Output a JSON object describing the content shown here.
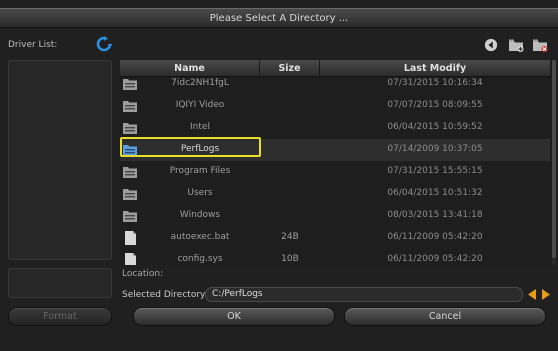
{
  "dialog": {
    "title": "Please Select A Directory ..."
  },
  "left_panel": {
    "driver_list_label": "Driver List:",
    "refresh_icon": "refresh-icon",
    "format_label": "Format"
  },
  "toolbar": {
    "icons": [
      "back-icon",
      "new-folder-icon",
      "delete-folder-icon"
    ]
  },
  "file_list": {
    "columns": [
      "Name",
      "Size",
      "Last Modify"
    ],
    "rows": [
      {
        "icon": "folder-icon",
        "name": "7idc2NH1fgL",
        "size": "",
        "modified": "07/31/2015 10:16:34"
      },
      {
        "icon": "folder-icon",
        "name": "IQIYI Video",
        "size": "",
        "modified": "07/07/2015 08:09:55"
      },
      {
        "icon": "folder-icon",
        "name": "Intel",
        "size": "",
        "modified": "06/04/2015 10:59:52"
      },
      {
        "icon": "folder-icon",
        "name": "PerfLogs",
        "size": "",
        "modified": "07/14/2009 10:37:05",
        "selected": true
      },
      {
        "icon": "folder-icon",
        "name": "Program Files",
        "size": "",
        "modified": "07/31/2015 15:55:15"
      },
      {
        "icon": "folder-icon",
        "name": "Users",
        "size": "",
        "modified": "06/04/2015 10:51:32"
      },
      {
        "icon": "folder-icon",
        "name": "Windows",
        "size": "",
        "modified": "08/03/2015 13:41:18"
      },
      {
        "icon": "file-icon",
        "name": "autoexec.bat",
        "size": "24B",
        "modified": "06/11/2009 05:42:20"
      },
      {
        "icon": "file-icon",
        "name": "config.sys",
        "size": "10B",
        "modified": "06/11/2009 05:42:20"
      }
    ]
  },
  "location": {
    "label": "Location:",
    "selected_label": "Selected Directory:",
    "selected_value": "C:/PerfLogs"
  },
  "buttons": {
    "ok_label": "OK",
    "cancel_label": "Cancel"
  },
  "colors": {
    "highlight": "#e9df2a",
    "accent": "#2a8fe0",
    "arrow": "#e89a1a"
  }
}
